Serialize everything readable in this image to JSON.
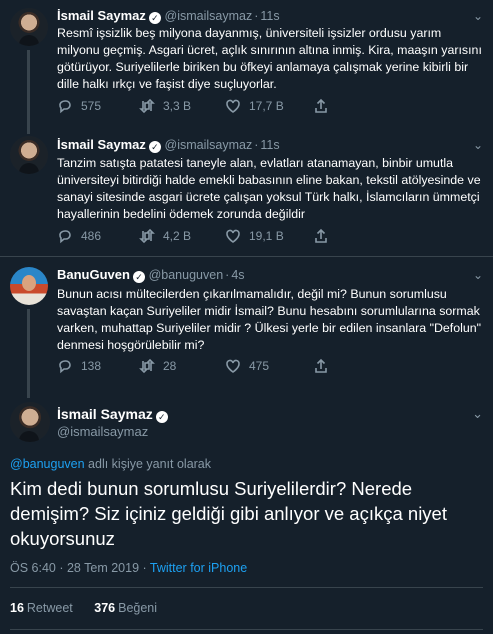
{
  "tweets": [
    {
      "name": "İsmail Saymaz",
      "handle": "@ismailsaymaz",
      "time": "11s",
      "text": "Resmî işsizlik beş milyona dayanmış, üniversiteli işsizler ordusu yarım milyonu geçmiş. Asgari ücret, açlık sınırının altına inmiş. Kira, maaşın yarısını götürüyor. Suriyelilerle biriken bu öfkeyi anlamaya çalışmak yerine kibirli bir dille halkı ırkçı ve faşist diye suçluyorlar.",
      "replies": "575",
      "retweets": "3,3 B",
      "likes": "17,7 B"
    },
    {
      "name": "İsmail Saymaz",
      "handle": "@ismailsaymaz",
      "time": "11s",
      "text": "Tanzim satışta patatesi taneyle alan, evlatları atanamayan, binbir umutla üniversiteyi bitirdiği halde emekli babasının eline bakan, tekstil atölyesinde ve sanayi sitesinde asgari ücrete çalışan yoksul Türk halkı, İslamcıların ümmetçi hayallerinin bedelini ödemek zorunda değildir",
      "replies": "486",
      "retweets": "4,2 B",
      "likes": "19,1 B"
    },
    {
      "name": "BanuGuven",
      "handle": "@banuguven",
      "time": "4s",
      "text": "Bunun acısı mültecilerden çıkarılmamalıdır, değil mi? Bunun sorumlusu savaştan kaçan Suriyeliler midir İsmail? Bunu hesabını sorumlularına sormak varken, muhattap Suriyeliler midir ? Ülkesi yerle bir edilen insanlara \"Defolun\" denmesi hoşgörülebilir mi?",
      "replies": "138",
      "retweets": "28",
      "likes": "475"
    }
  ],
  "main": {
    "name": "İsmail Saymaz",
    "handle": "@ismailsaymaz",
    "reply_to_handle": "@banuguven",
    "reply_to_suffix": " adlı kişiye yanıt olarak",
    "text": "Kim dedi bunun sorumlusu Suriyelilerdir? Nerede demişim? Siz içiniz geldiği gibi anlıyor ve açıkça niyet okuyorsunuz",
    "time": "ÖS 6:40 · 28 Tem 2019 · ",
    "source": "Twitter for iPhone",
    "retweet_count": "16",
    "retweet_label": "Retweet",
    "like_count": "376",
    "like_label": "Beğeni"
  },
  "icons": {
    "verified": "verified-badge-icon",
    "reply": "reply-icon",
    "retweet": "retweet-icon",
    "like": "heart-icon",
    "more": "chevron-down-icon"
  },
  "colors": {
    "background": "#15202b",
    "text_secondary": "#8899a6",
    "link": "#1da1f2",
    "border": "#38444d"
  }
}
